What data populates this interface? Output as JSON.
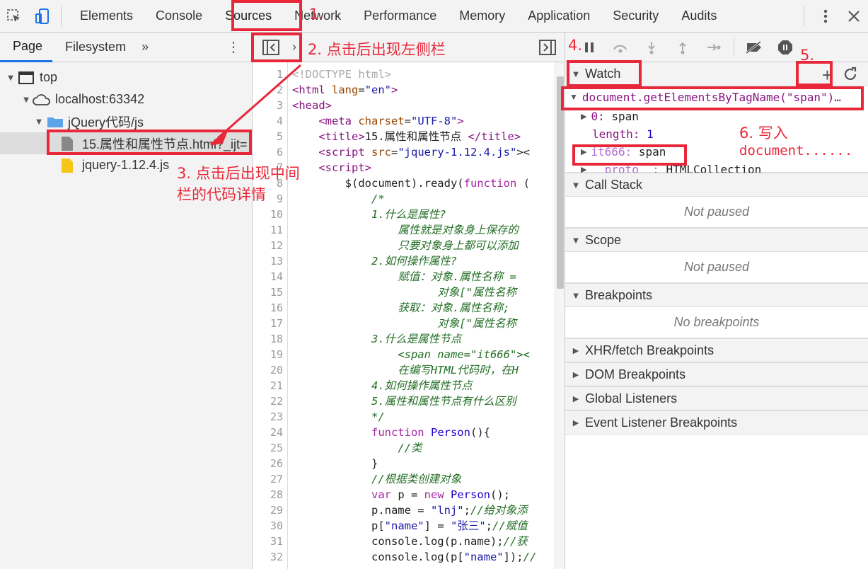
{
  "toolbar": {
    "tabs": [
      "Elements",
      "Console",
      "Sources",
      "Network",
      "Performance",
      "Memory",
      "Application",
      "Security",
      "Audits"
    ]
  },
  "navigator": {
    "tabs": [
      "Page",
      "Filesystem"
    ],
    "more": "»",
    "tree": {
      "top": "top",
      "host": "localhost:63342",
      "folder": "jQuery代码/js",
      "file_selected": "15.属性和属性节点.html?_ijt=",
      "file_js": "jquery-1.12.4.js"
    }
  },
  "editor": {
    "line_numbers": [
      "1",
      "2",
      "3",
      "4",
      "5",
      "6",
      "7",
      "8",
      "9",
      "10",
      "11",
      "12",
      "13",
      "14",
      "15",
      "16",
      "17",
      "18",
      "19",
      "20",
      "21",
      "22",
      "23",
      "24",
      "25",
      "26",
      "27",
      "28",
      "29",
      "30",
      "31",
      "32"
    ]
  },
  "debugger": {
    "watch": {
      "title": "Watch",
      "expression": "document.getElementsByTagName(\"span\")…",
      "row0_key": "0:",
      "row0_val": "span",
      "row1_key": "length:",
      "row1_val": "1",
      "row2_key": "it666:",
      "row2_val": "span",
      "row3_key": "__proto__:",
      "row3_val": "HTMLCollection"
    },
    "call_stack": {
      "title": "Call Stack",
      "empty": "Not paused"
    },
    "scope": {
      "title": "Scope",
      "empty": "Not paused"
    },
    "breakpoints": {
      "title": "Breakpoints",
      "empty": "No breakpoints"
    },
    "xhr": "XHR/fetch Breakpoints",
    "dom": "DOM Breakpoints",
    "global": "Global Listeners",
    "event": "Event Listener Breakpoints"
  },
  "annotations": {
    "a1": "1.",
    "a2": "2. 点击后出现左侧栏",
    "a3_line1": "3. 点击后出现中间",
    "a3_line2": "栏的代码详情",
    "a4": "4.",
    "a5": "5.",
    "a6_line1": "6. 写入",
    "a6_line2": "document......"
  },
  "colors": {
    "annotation": "#e8283a",
    "active_tab": "#1a73e8"
  }
}
